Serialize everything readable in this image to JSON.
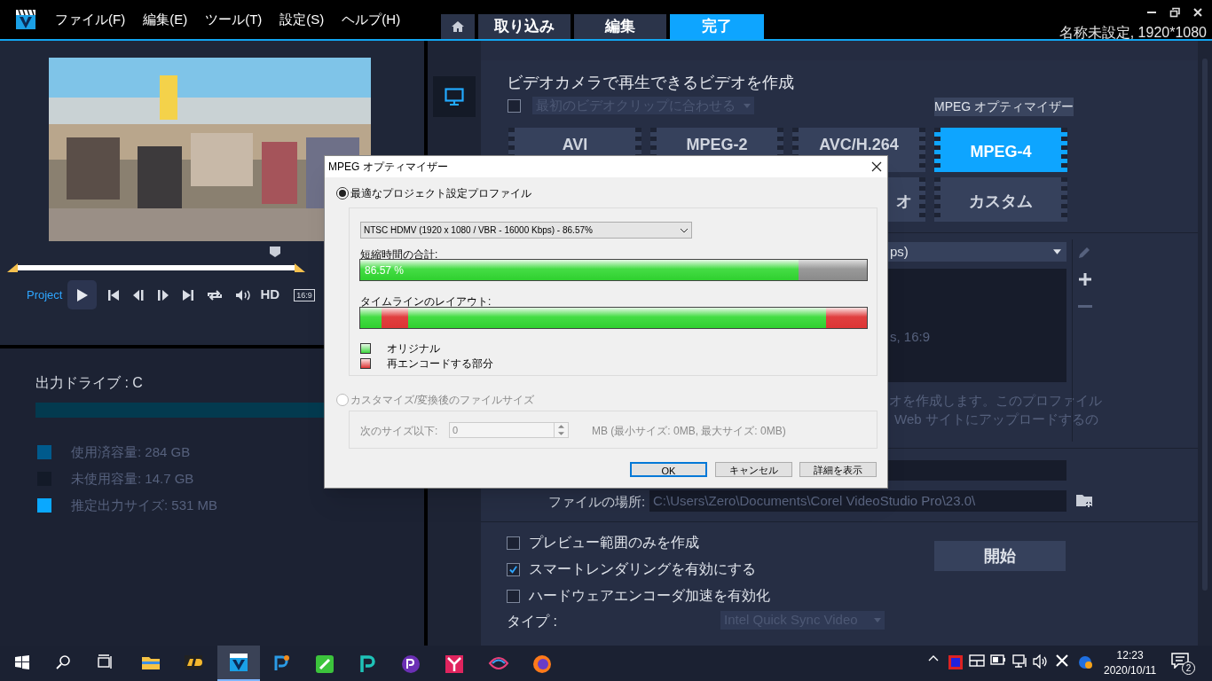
{
  "menu_bar": {
    "items": [
      "ファイル(F)",
      "編集(E)",
      "ツール(T)",
      "設定(S)",
      "ヘルプ(H)"
    ]
  },
  "mode_tabs": [
    {
      "label": "取り込み",
      "selected": false
    },
    {
      "label": "編集",
      "selected": false
    },
    {
      "label": "完了",
      "selected": true
    }
  ],
  "window": {
    "title": "名称未設定, 1920*1080"
  },
  "player": {
    "project_label": "Project",
    "quality_label": "HD",
    "aspect_label": "16:9",
    "level": 0.9
  },
  "drive": {
    "title": "出力ドライブ : C",
    "legend": [
      {
        "label": "使用済容量: 284 GB",
        "color": "#005a8c"
      },
      {
        "label": "未使用容量: 14.7 GB",
        "color": "#131a28"
      },
      {
        "label": "推定出力サイズ: 531 MB",
        "color": "#0aa8ff"
      }
    ]
  },
  "output": {
    "heading": "ビデオカメラで再生できるビデオを作成",
    "match_first_clip": {
      "label": "最初のビデオクリップに合わせる",
      "checked": false
    },
    "optimizer_button": "MPEG オプティマイザー",
    "formats": [
      {
        "label": "AVI",
        "selected": false
      },
      {
        "label": "MPEG-2",
        "selected": false
      },
      {
        "label": "AVC/H.264",
        "selected": false
      },
      {
        "label": "MPEG-4",
        "selected": true
      },
      {
        "label": "オ",
        "selected": false
      },
      {
        "label": "カスタム",
        "selected": false
      }
    ],
    "profile_dropdown": "ps)",
    "profile_details": "s, 16:9",
    "description_lines": [
      "オを作成します。このプロファイル",
      "Web サイトにアップロードするの"
    ],
    "file_location_label": "ファイルの場所:",
    "file_location": "C:\\Users\\Zero\\Documents\\Corel VideoStudio Pro\\23.0\\",
    "options": [
      {
        "label": "プレビュー範囲のみを作成",
        "checked": false
      },
      {
        "label": "スマートレンダリングを有効にする",
        "checked": true
      },
      {
        "label": "ハードウェアエンコーダ加速を有効化",
        "checked": false
      }
    ],
    "start_button": "開始",
    "type_label": "タイプ :",
    "type_dropdown": "Intel Quick Sync Video"
  },
  "dialog": {
    "title": "MPEG オプティマイザー",
    "options": [
      {
        "label": "最適なプロジェクト設定プロファイル",
        "selected": true
      },
      {
        "label": "カスタマイズ/変換後のファイルサイズ",
        "selected": false
      }
    ],
    "profile": "NTSC HDMV (1920 x 1080 / VBR - 16000 Kbps) - 86.57%",
    "saved_bar": {
      "label": "短縮時間の合計:",
      "level": 0.8657,
      "reading": "86.57 %"
    },
    "layout_label": "タイムラインのレイアウト:",
    "segments": [
      {
        "kind": "original"
      },
      {
        "kind": "reencode"
      },
      {
        "kind": "original"
      },
      {
        "kind": "reencode"
      }
    ],
    "legend": [
      {
        "kind": "original",
        "label": "オリジナル"
      },
      {
        "kind": "reencode",
        "label": "再エンコードする部分"
      }
    ],
    "size_label": "次のサイズ以下:",
    "size_value": "0",
    "size_note": "MB (最小サイズ: 0MB, 最大サイズ: 0MB)",
    "buttons": [
      "OK",
      "キャンセル",
      "詳細を表示"
    ]
  },
  "taskbar": {
    "time": "12:23",
    "date": "2020/10/11",
    "notification_count": "2"
  }
}
